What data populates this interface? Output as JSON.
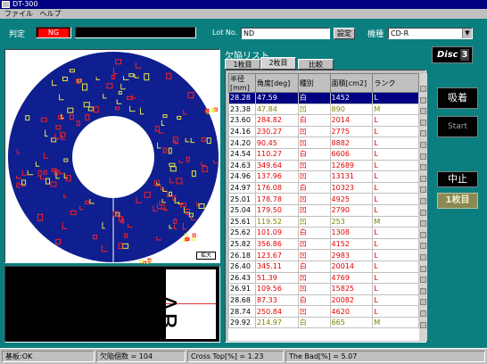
{
  "window": {
    "title": "DT-300"
  },
  "menu": {
    "items": [
      "ファイル",
      "ヘルプ"
    ]
  },
  "judge": {
    "label": "判定",
    "result": "NG"
  },
  "lot": {
    "label": "Lot No.",
    "value": "ND",
    "button": "設定"
  },
  "model": {
    "label": "機種",
    "value": "CD-R"
  },
  "map": {
    "corner_label": "拡大"
  },
  "image": {
    "text": "AB"
  },
  "list": {
    "title": "欠陥リスト",
    "tabs": [
      "1枚目",
      "2枚目",
      "比較"
    ],
    "columns": [
      "半径[mm]",
      "角度[deg]",
      "種別",
      "面積[cm2]",
      "ランク"
    ],
    "rows": [
      [
        "28.28",
        "47.59",
        "白",
        "1452",
        "L"
      ],
      [
        "23.38",
        "47.84",
        "凹",
        "890",
        "M"
      ],
      [
        "23.60",
        "284.82",
        "白",
        "2014",
        "L"
      ],
      [
        "24.16",
        "230.27",
        "凹",
        "2775",
        "L"
      ],
      [
        "24.20",
        "90.45",
        "凹",
        "8882",
        "L"
      ],
      [
        "24.54",
        "110.27",
        "白",
        "6606",
        "L"
      ],
      [
        "24.63",
        "349.64",
        "凹",
        "12689",
        "L"
      ],
      [
        "24.96",
        "137.96",
        "凹",
        "13131",
        "L"
      ],
      [
        "24.97",
        "176.08",
        "白",
        "10323",
        "L"
      ],
      [
        "25.01",
        "178.78",
        "凹",
        "4925",
        "L"
      ],
      [
        "25.04",
        "179.50",
        "凹",
        "2790",
        "L"
      ],
      [
        "25.61",
        "119.52",
        "凹",
        "253",
        "M"
      ],
      [
        "25.62",
        "101.09",
        "白",
        "1308",
        "L"
      ],
      [
        "25.82",
        "356.86",
        "凹",
        "4152",
        "L"
      ],
      [
        "26.18",
        "123.67",
        "凹",
        "2983",
        "L"
      ],
      [
        "26.40",
        "345.11",
        "白",
        "20014",
        "L"
      ],
      [
        "26.43",
        "51.39",
        "凹",
        "4769",
        "L"
      ],
      [
        "26.91",
        "109.56",
        "凹",
        "15825",
        "L"
      ],
      [
        "28.68",
        "87.33",
        "白",
        "20082",
        "L"
      ],
      [
        "28.74",
        "250.84",
        "凹",
        "4620",
        "L"
      ],
      [
        "29.92",
        "214.97",
        "白",
        "665",
        "M"
      ]
    ]
  },
  "side": {
    "disc_label": "Disc",
    "disc_number": "3",
    "btn1": "吸着",
    "btn2": "Start",
    "btn3": "中止",
    "btn4": "1枚目"
  },
  "status": {
    "cells": [
      "基板:OK",
      "欠陥個数 = 104",
      "Cross Top[%] = 1.23",
      "The Bad[%] = 5.07"
    ]
  },
  "colors": {
    "disc": "#0f1f8f",
    "defect_red": "#ff2020",
    "defect_yellow": "#e8e840"
  }
}
